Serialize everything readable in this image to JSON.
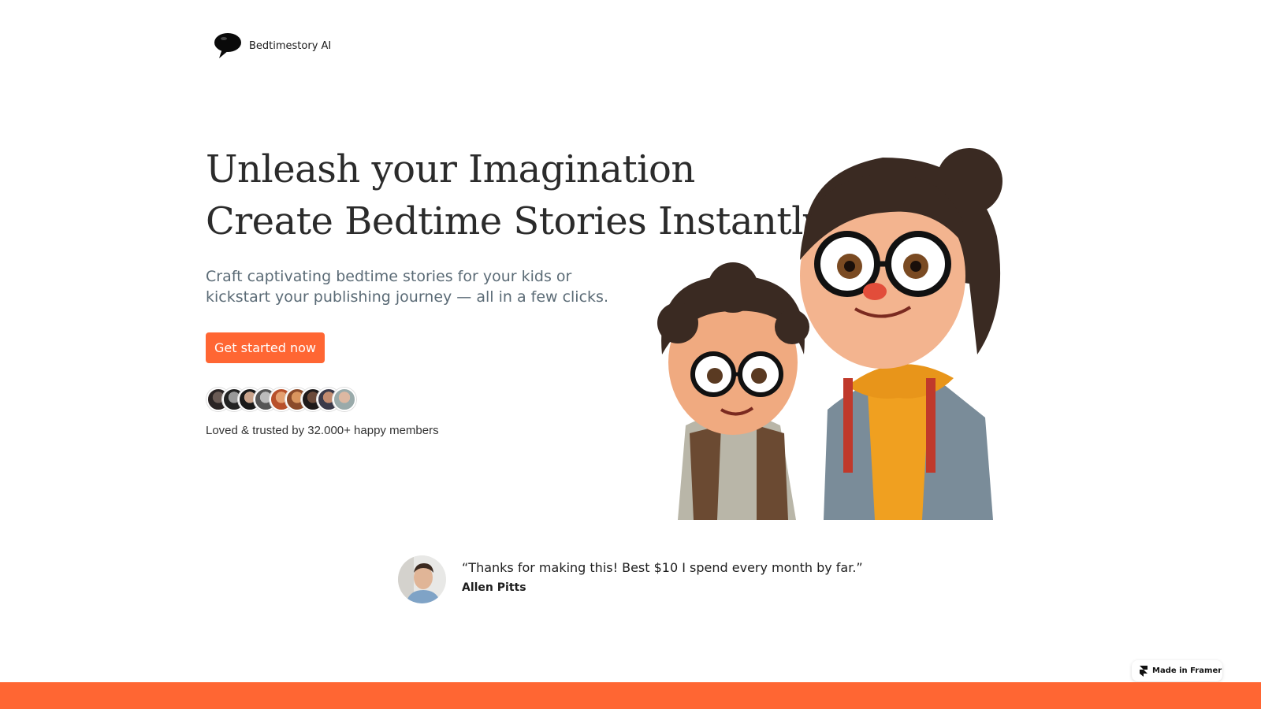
{
  "brand": {
    "name": "Bedtimestory AI"
  },
  "hero": {
    "title_line1": "Unleash your Imagination",
    "title_line2": "Create Bedtime Stories Instantly",
    "subtitle_line1": "Craft captivating bedtime stories for your kids or",
    "subtitle_line2": "kickstart your publishing journey — all in a few clicks.",
    "cta_label": "Get started now",
    "members_text": "Loved & trusted by 32.000+ happy members"
  },
  "testimonial": {
    "quote": "“Thanks for making this! Best $10 I spend every month by far.”",
    "author": "Allen Pitts"
  },
  "badge": {
    "label": "Made in Framer"
  },
  "colors": {
    "accent": "#ff6633",
    "text": "#2b2b2b",
    "muted": "#5b6b76"
  },
  "icons": [
    "speech-bubble-logo-icon",
    "framer-icon"
  ]
}
